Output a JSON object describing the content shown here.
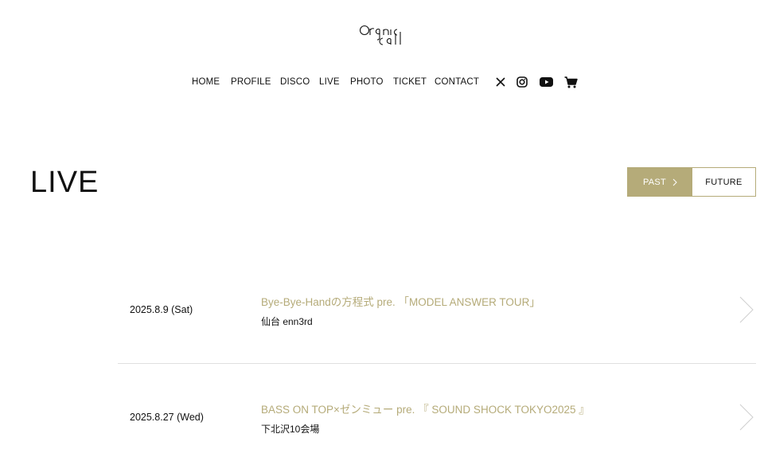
{
  "logo": {
    "text": "Organic Call"
  },
  "nav": {
    "items": [
      {
        "label": "HOME"
      },
      {
        "label": "PROFILE"
      },
      {
        "label": "DISCO"
      },
      {
        "label": "LIVE"
      },
      {
        "label": "PHOTO"
      },
      {
        "label": "TICKET"
      },
      {
        "label": "CONTACT"
      }
    ],
    "social": [
      "x-icon",
      "instagram-icon",
      "youtube-icon",
      "cart-icon"
    ]
  },
  "page": {
    "title": "LIVE"
  },
  "toggle": {
    "past_label": "PAST",
    "future_label": "FUTURE",
    "active": "PAST"
  },
  "colors": {
    "accent": "#b5ab79",
    "text": "#111111",
    "divider": "#e0e0e0"
  },
  "lives": [
    {
      "date": "2025.8.9 (Sat)",
      "title": "Bye-Bye-Handの方程式 pre. 「MODEL ANSWER TOUR」",
      "venue": "仙台 enn3rd"
    },
    {
      "date": "2025.8.27 (Wed)",
      "title": "BASS ON TOP×ゼンミュー pre. 『 SOUND SHOCK TOKYO2025 』",
      "venue": "下北沢10会場"
    }
  ]
}
